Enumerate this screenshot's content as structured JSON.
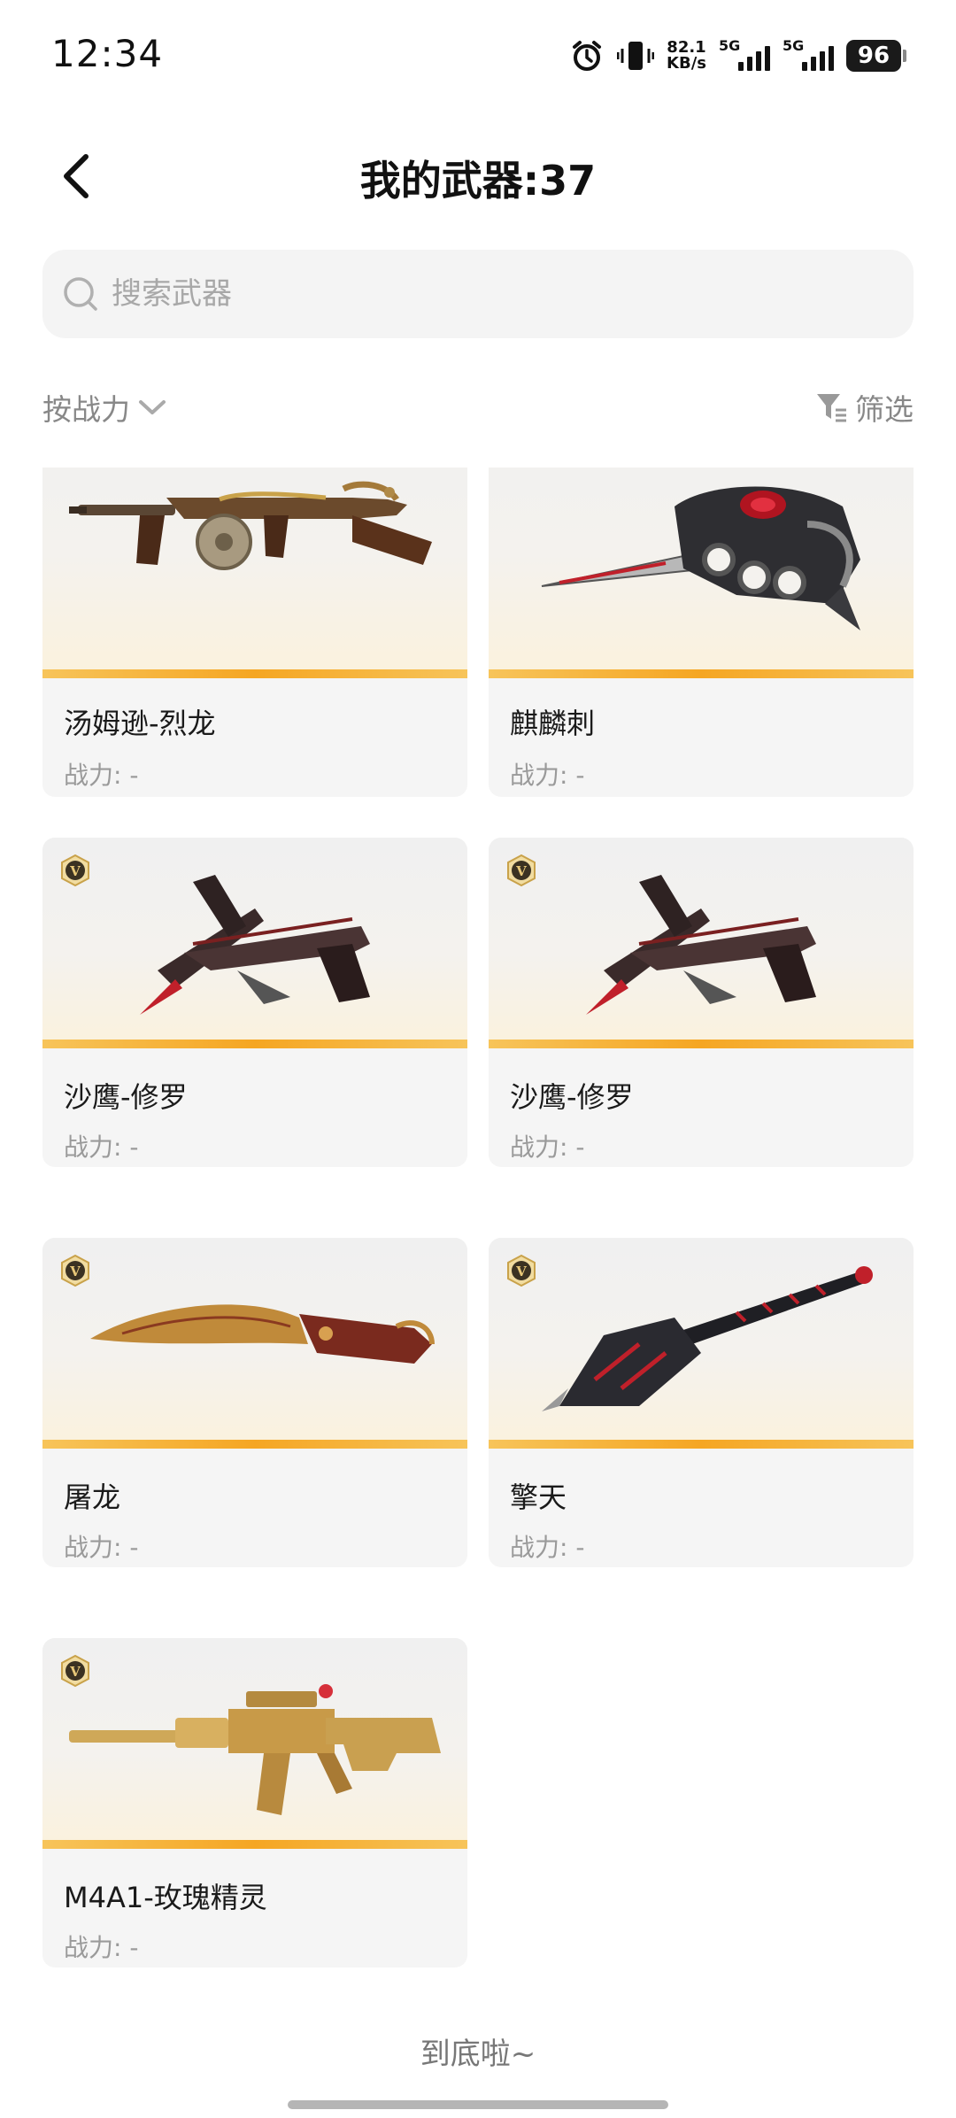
{
  "status_bar": {
    "time": "12:34",
    "net_speed_value": "82.1",
    "net_speed_unit": "KB/s",
    "sim1_label": "5G",
    "sim2_label": "5G",
    "battery": "96"
  },
  "header": {
    "title": "我的武器:37"
  },
  "search": {
    "placeholder": "搜索武器"
  },
  "sort": {
    "label": "按战力"
  },
  "filter": {
    "label": "筛选"
  },
  "weapons": [
    {
      "name": "汤姆逊-烈龙",
      "power": "战力: -",
      "icon": "tommy-gun-icon"
    },
    {
      "name": "麒麟刺",
      "power": "战力: -",
      "icon": "knuckle-blade-icon"
    },
    {
      "name": "沙鹰-修罗",
      "power": "战力: -",
      "icon": "desert-eagle-icon"
    },
    {
      "name": "沙鹰-修罗",
      "power": "战力: -",
      "icon": "desert-eagle-icon"
    },
    {
      "name": "屠龙",
      "power": "战力: -",
      "icon": "kukri-knife-icon"
    },
    {
      "name": "擎天",
      "power": "战力: -",
      "icon": "shovel-icon"
    },
    {
      "name": "M4A1-玫瑰精灵",
      "power": "战力: -",
      "icon": "rifle-icon"
    }
  ],
  "footer": {
    "end_text": "到底啦~"
  },
  "colors": {
    "accent_stripe": "#f5a623",
    "card_bg": "#f5f5f5",
    "badge_gold": "#c9a24a"
  }
}
